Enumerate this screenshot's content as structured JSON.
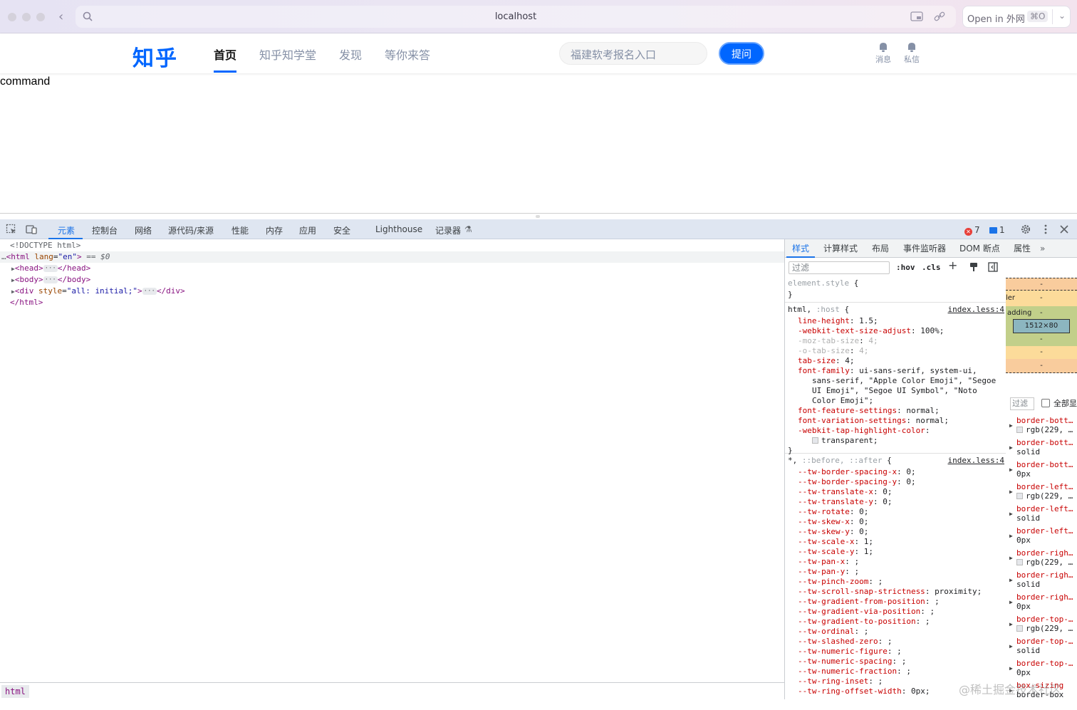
{
  "browser": {
    "url": "localhost",
    "open_in_label": "Open in 外网",
    "open_in_shortcut": "⌘O",
    "back_icon": "chevron-left-icon"
  },
  "zhihu": {
    "logo": "知乎",
    "nav": [
      "首页",
      "知乎知学堂",
      "发现",
      "等你来答"
    ],
    "search_placeholder": "福建软考报名入口",
    "ask_button": "提问",
    "messages_label": "消息",
    "private_msg_label": "私信",
    "accent_color": "#0066ff"
  },
  "page_text": "command",
  "devtools": {
    "tabs": [
      "元素",
      "控制台",
      "网络",
      "源代码/来源",
      "性能",
      "内存",
      "应用",
      "安全",
      "Lighthouse",
      "记录器"
    ],
    "error_count": "7",
    "message_count": "1",
    "elements": {
      "doctype": "<!DOCTYPE html>",
      "html_open": "<html",
      "lang_attr": "lang",
      "lang_val": "\"en\"",
      "selected_marker": "== $0",
      "head_open": "<head>",
      "head_close": "</head>",
      "body_open": "<body>",
      "body_close": "</body>",
      "div_open": "<div",
      "style_attr": "style",
      "style_val": "\"all: initial;\"",
      "div_close": "</div>",
      "html_close": "</html>",
      "breadcrumb": "html"
    },
    "styles": {
      "tabs": [
        "样式",
        "计算样式",
        "布局",
        "事件监听器",
        "DOM 断点",
        "属性"
      ],
      "filter_placeholder": "过滤",
      "hov": ":hov",
      "cls": ".cls",
      "element_style": "element.style",
      "rule1_selector": "html",
      "rule1_selector_dim": ":host",
      "rule1_source": "index.less:4",
      "rule1_decls": [
        {
          "p": "line-height",
          "v": "1.5;",
          "dim": false
        },
        {
          "p": "-webkit-text-size-adjust",
          "v": "100%;",
          "dim": false
        },
        {
          "p": "-moz-tab-size",
          "v": "4;",
          "dim": true
        },
        {
          "p": "-o-tab-size",
          "v": "4;",
          "dim": true
        },
        {
          "p": "tab-size",
          "v": "4;",
          "dim": false
        },
        {
          "p": "font-family",
          "v": "ui-sans-serif, system-ui,",
          "dim": false
        },
        {
          "p": "",
          "v": "sans-serif, \"Apple Color Emoji\", \"Segoe",
          "dim": false
        },
        {
          "p": "",
          "v": "UI Emoji\", \"Segoe UI Symbol\", \"Noto",
          "dim": false
        },
        {
          "p": "",
          "v": "Color Emoji\";",
          "dim": false
        },
        {
          "p": "font-feature-settings",
          "v": "normal;",
          "dim": false
        },
        {
          "p": "font-variation-settings",
          "v": "normal;",
          "dim": false
        },
        {
          "p": "-webkit-tap-highlight-color",
          "v": "",
          "dim": false
        },
        {
          "p": "",
          "v": "transparent;",
          "dim": false
        }
      ],
      "rule2_selector": "*,",
      "rule2_selector_dim": "::before, ::after",
      "rule2_source": "index.less:4",
      "rule2_decls": [
        {
          "p": "--tw-border-spacing-x",
          "v": "0;"
        },
        {
          "p": "--tw-border-spacing-y",
          "v": "0;"
        },
        {
          "p": "--tw-translate-x",
          "v": "0;"
        },
        {
          "p": "--tw-translate-y",
          "v": "0;"
        },
        {
          "p": "--tw-rotate",
          "v": "0;"
        },
        {
          "p": "--tw-skew-x",
          "v": "0;"
        },
        {
          "p": "--tw-skew-y",
          "v": "0;"
        },
        {
          "p": "--tw-scale-x",
          "v": "1;"
        },
        {
          "p": "--tw-scale-y",
          "v": "1;"
        },
        {
          "p": "--tw-pan-x",
          "v": ";"
        },
        {
          "p": "--tw-pan-y",
          "v": ";"
        },
        {
          "p": "--tw-pinch-zoom",
          "v": ";"
        },
        {
          "p": "--tw-scroll-snap-strictness",
          "v": "proximity;"
        },
        {
          "p": "--tw-gradient-from-position",
          "v": ";"
        },
        {
          "p": "--tw-gradient-via-position",
          "v": ";"
        },
        {
          "p": "--tw-gradient-to-position",
          "v": ";"
        },
        {
          "p": "--tw-ordinal",
          "v": ";"
        },
        {
          "p": "--tw-slashed-zero",
          "v": ";"
        },
        {
          "p": "--tw-numeric-figure",
          "v": ";"
        },
        {
          "p": "--tw-numeric-spacing",
          "v": ";"
        },
        {
          "p": "--tw-numeric-fraction",
          "v": ";"
        },
        {
          "p": "--tw-ring-inset",
          "v": ";"
        },
        {
          "p": "--tw-ring-offset-width",
          "v": "0px;"
        }
      ]
    },
    "computed": {
      "box_labels": [
        "-",
        "ler",
        "-",
        "adding",
        "-",
        "1512×80",
        "-",
        "-",
        "-"
      ],
      "filter_placeholder": "过滤",
      "show_all": "全部显",
      "props": [
        {
          "n": "border-bott…",
          "v": "rgb(229, …",
          "swatch": true
        },
        {
          "n": "border-bott…",
          "v": "solid",
          "swatch": false
        },
        {
          "n": "border-bott…",
          "v": "0px",
          "swatch": false
        },
        {
          "n": "border-left…",
          "v": "rgb(229, …",
          "swatch": true
        },
        {
          "n": "border-left…",
          "v": "solid",
          "swatch": false
        },
        {
          "n": "border-left…",
          "v": "0px",
          "swatch": false
        },
        {
          "n": "border-righ…",
          "v": "rgb(229, …",
          "swatch": true
        },
        {
          "n": "border-righ…",
          "v": "solid",
          "swatch": false
        },
        {
          "n": "border-righ…",
          "v": "0px",
          "swatch": false
        },
        {
          "n": "border-top-…",
          "v": "rgb(229, …",
          "swatch": true
        },
        {
          "n": "border-top-…",
          "v": "solid",
          "swatch": false
        },
        {
          "n": "border-top-…",
          "v": "0px",
          "swatch": false
        },
        {
          "n": "box-sizing",
          "v": "border-box",
          "swatch": false
        }
      ]
    }
  },
  "watermark": "@稀土掘金技术社区"
}
